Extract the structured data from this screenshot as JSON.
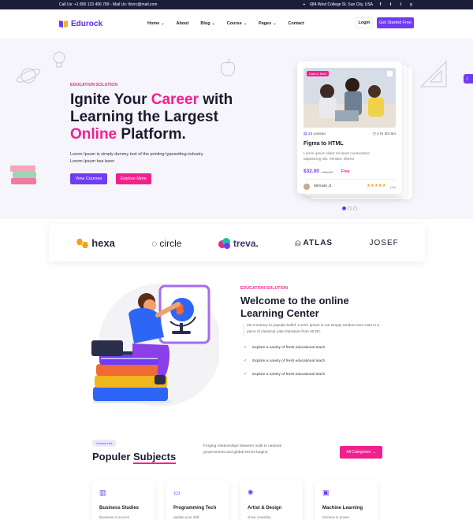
{
  "topbar": {
    "contact": "Call Us: +1 800 123 456 789 - Mail Us: ifcirrc@mail.com",
    "address": "684 West College St. Sun City, USA",
    "social": [
      "f",
      "t",
      "i",
      "y"
    ]
  },
  "header": {
    "brand": "Edurock",
    "nav": [
      {
        "label": "Home",
        "dropdown": true
      },
      {
        "label": "About",
        "dropdown": false
      },
      {
        "label": "Blog",
        "dropdown": true
      },
      {
        "label": "Course",
        "dropdown": true
      },
      {
        "label": "Pages",
        "dropdown": true
      },
      {
        "label": "Contact",
        "dropdown": false
      }
    ],
    "login_label": "Login",
    "start_label": "Get Started Free"
  },
  "hero": {
    "eyebrow": "EDUCATION SOLUTION",
    "title_1": "Ignite Your ",
    "title_2": "Career",
    "title_3": " with",
    "title_4": "Learning the Largest",
    "title_5": "Online",
    "title_6": " Platform.",
    "description": "Lorem Ipsum is simply dummy text of the printing typesetting industry. Lorem Ipsum has been",
    "btn_courses": "View Courses",
    "btn_explore": "Explore More"
  },
  "course_card": {
    "tag": "Data & Tech",
    "lessons": "23 Lesson",
    "duration": "1 hr 30 min",
    "title": "Figma to HTML",
    "description": "Lorem ipsum dolor sit amet consectetur, adipisicing elit. Veniam, libero!",
    "price": "$32.00",
    "old_price": "/ $67.00",
    "free": "Free",
    "author": "Mirnsdo Jt",
    "stars": "★★★★★",
    "rating_count": "(44)"
  },
  "slider": {
    "active": 0,
    "count": 3
  },
  "partners": [
    "hexa",
    "circle",
    "treva.",
    "ATLAS",
    "JOSEF"
  ],
  "welcome": {
    "eyebrow": "EDUCATION SOLUTION",
    "title_1": "Welcome to the online",
    "title_2": "Learning Center",
    "description": "25+Contrary to popular belief, Lorem Ipsum is not simply random text roots in a piece of classical Latin literature from 45 BC",
    "checks": [
      "Explore a variety of fresh educational teach",
      "Explore a variety of fresh educational teach",
      "Explore a variety of fresh educational teach"
    ]
  },
  "subjects": {
    "pill": "Course List",
    "title_1": "Populer ",
    "title_2": "Subjects",
    "description": "Forging relationships between multi to national governments and global NGOs begins.",
    "btn_categories": "All Categories",
    "cards": [
      {
        "title": "Business Studies",
        "desc": "Business is succes",
        "icon": "chart-icon"
      },
      {
        "title": "Programming Tech",
        "desc": "update your skill",
        "icon": "laptop-icon"
      },
      {
        "title": "Artist & Design",
        "desc": "show creativity",
        "icon": "bulb-icon"
      },
      {
        "title": "Machine Learning",
        "desc": "Science is power",
        "icon": "robot-icon"
      }
    ]
  },
  "colors": {
    "primary": "#6f3cf3",
    "accent": "#f1208e",
    "dark": "#1c1d3a"
  }
}
